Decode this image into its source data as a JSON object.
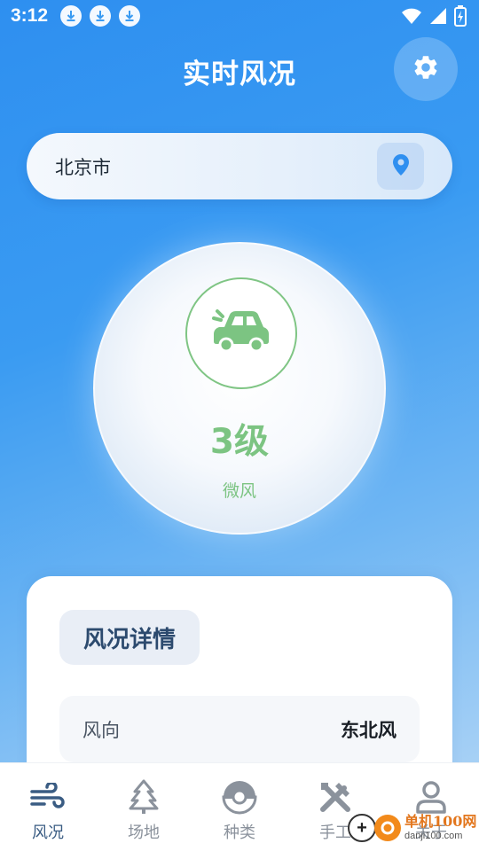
{
  "status_bar": {
    "time": "3:12",
    "icons": [
      "download-icon",
      "download-icon",
      "download-icon",
      "wifi-icon",
      "signal-icon",
      "battery-charging-icon"
    ]
  },
  "header": {
    "title": "实时风况",
    "settings_icon": "gear-icon"
  },
  "search": {
    "city": "北京市",
    "location_icon": "location-pin-icon"
  },
  "wind": {
    "level": "3级",
    "description": "微风",
    "icon": "car-icon",
    "accent_color": "#7cc482"
  },
  "details": {
    "title": "风况详情",
    "rows": [
      {
        "label": "风向",
        "value": "东北风"
      }
    ]
  },
  "bottom_nav": {
    "items": [
      {
        "label": "风况",
        "icon": "wind-icon",
        "active": true
      },
      {
        "label": "场地",
        "icon": "tree-icon",
        "active": false
      },
      {
        "label": "种类",
        "icon": "pokeball-icon",
        "active": false
      },
      {
        "label": "手工",
        "icon": "tools-icon",
        "active": false
      },
      {
        "label": "关于",
        "icon": "user-icon",
        "active": false
      }
    ]
  },
  "watermark": {
    "name": "单机100网",
    "url": "danji100.com"
  },
  "colors": {
    "background_top": "#2e8ff0",
    "primary_text": "#2c4a6e",
    "nav_active": "#3a5c83",
    "nav_inactive": "#8b929c"
  }
}
